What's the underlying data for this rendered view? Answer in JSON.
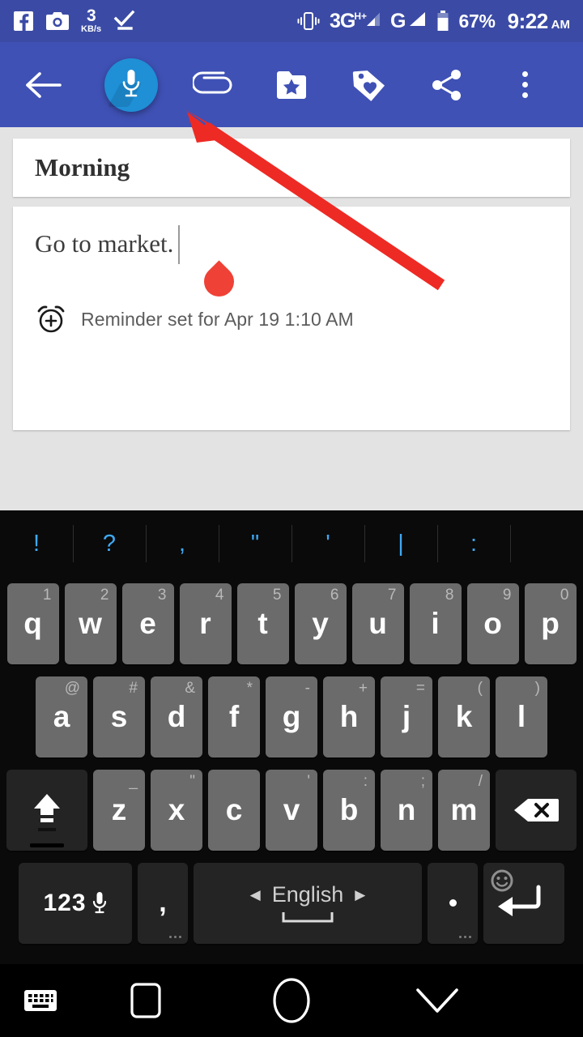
{
  "status_bar": {
    "icons_left": [
      "facebook-icon",
      "camera-icon",
      "network-speed",
      "checkmark-icon"
    ],
    "network_speed_value": "3",
    "network_speed_unit": "KB/s",
    "vibrate_icon": "vibrate-icon",
    "network_primary": "3G",
    "network_primary_sup": "H+",
    "network_secondary": "G",
    "battery_percent": "67%",
    "time": "9:22",
    "time_period": "AM",
    "background_color": "#3b4ba5"
  },
  "toolbar": {
    "background_color": "#3f51b5",
    "back_label": "back-arrow",
    "mic_label": "voice-input",
    "mic_highlight_color": "#1f8fd6",
    "attach_label": "attachment",
    "favorite_label": "add-to-favorites",
    "tag_label": "label-tag",
    "share_label": "share",
    "overflow_label": "more-options"
  },
  "note": {
    "title": "Morning",
    "body_text": "Go to market.",
    "reminder_text": "Reminder set for Apr 19 1:10 AM",
    "reminder_icon": "alarm-add-icon",
    "handle_color": "#ef4136"
  },
  "annotation": {
    "arrow_color": "#ee2a25",
    "points_to": "voice-input-microphone-button"
  },
  "keyboard": {
    "suggestions": [
      "!",
      "?",
      ",",
      "\"",
      "'",
      "|",
      ":"
    ],
    "row1": [
      {
        "key": "q",
        "hint": "1"
      },
      {
        "key": "w",
        "hint": "2"
      },
      {
        "key": "e",
        "hint": "3"
      },
      {
        "key": "r",
        "hint": "4"
      },
      {
        "key": "t",
        "hint": "5"
      },
      {
        "key": "y",
        "hint": "6"
      },
      {
        "key": "u",
        "hint": "7"
      },
      {
        "key": "i",
        "hint": "8"
      },
      {
        "key": "o",
        "hint": "9"
      },
      {
        "key": "p",
        "hint": "0"
      }
    ],
    "row2": [
      {
        "key": "a",
        "hint": "@"
      },
      {
        "key": "s",
        "hint": "#"
      },
      {
        "key": "d",
        "hint": "&"
      },
      {
        "key": "f",
        "hint": "*"
      },
      {
        "key": "g",
        "hint": "-"
      },
      {
        "key": "h",
        "hint": "+"
      },
      {
        "key": "j",
        "hint": "="
      },
      {
        "key": "k",
        "hint": "("
      },
      {
        "key": "l",
        "hint": ")"
      }
    ],
    "row3": [
      {
        "key": "z",
        "hint": "_"
      },
      {
        "key": "x",
        "hint": "\""
      },
      {
        "key": "c",
        "hint": ""
      },
      {
        "key": "v",
        "hint": "'"
      },
      {
        "key": "b",
        "hint": ":"
      },
      {
        "key": "n",
        "hint": ";"
      },
      {
        "key": "m",
        "hint": "/"
      }
    ],
    "shift_label": "shift-key",
    "backspace_label": "backspace-key",
    "num_label": "123",
    "num_mic_label": "voice-typing",
    "comma_label": ",",
    "space_language": "English",
    "space_prev_arrow": "◀",
    "space_next_arrow": "▶",
    "period_label": ".",
    "enter_label": "enter-key",
    "emoji_label": "emoji-key"
  },
  "nav_bar": {
    "keyboard_toggle": "keyboard-icon",
    "recents": "recents-square",
    "home": "home-circle",
    "dismiss": "chevron-down"
  }
}
